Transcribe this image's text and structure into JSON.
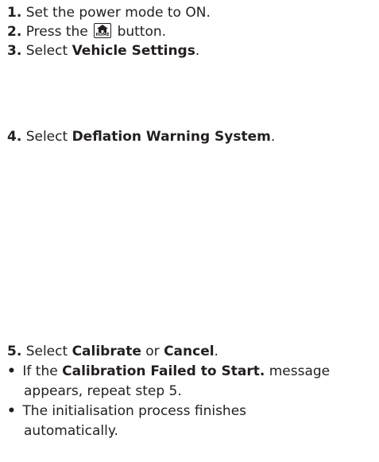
{
  "steps": [
    {
      "num": "1.",
      "text": "Set the power mode to ON."
    },
    {
      "num": "2.",
      "pre": "Press the",
      "icon_label": "HOME",
      "icon": "home-icon",
      "post": "button."
    },
    {
      "num": "3.",
      "pre": "Select",
      "bold": "Vehicle Settings",
      "post": "."
    },
    {
      "num": "4.",
      "pre": "Select",
      "bold": "Deflation Warning System",
      "post": "."
    },
    {
      "num": "5.",
      "pre": "Select",
      "bold1": "Calibrate",
      "mid": "or",
      "bold2": "Cancel",
      "post": "."
    }
  ],
  "bullets": [
    {
      "symbol": "•",
      "pre": "If the",
      "bold": "Calibration Failed to Start.",
      "post": "message",
      "cont": "appears, repeat step 5."
    },
    {
      "symbol": "•",
      "text": "The initialisation process finishes",
      "cont": "automatically."
    }
  ]
}
